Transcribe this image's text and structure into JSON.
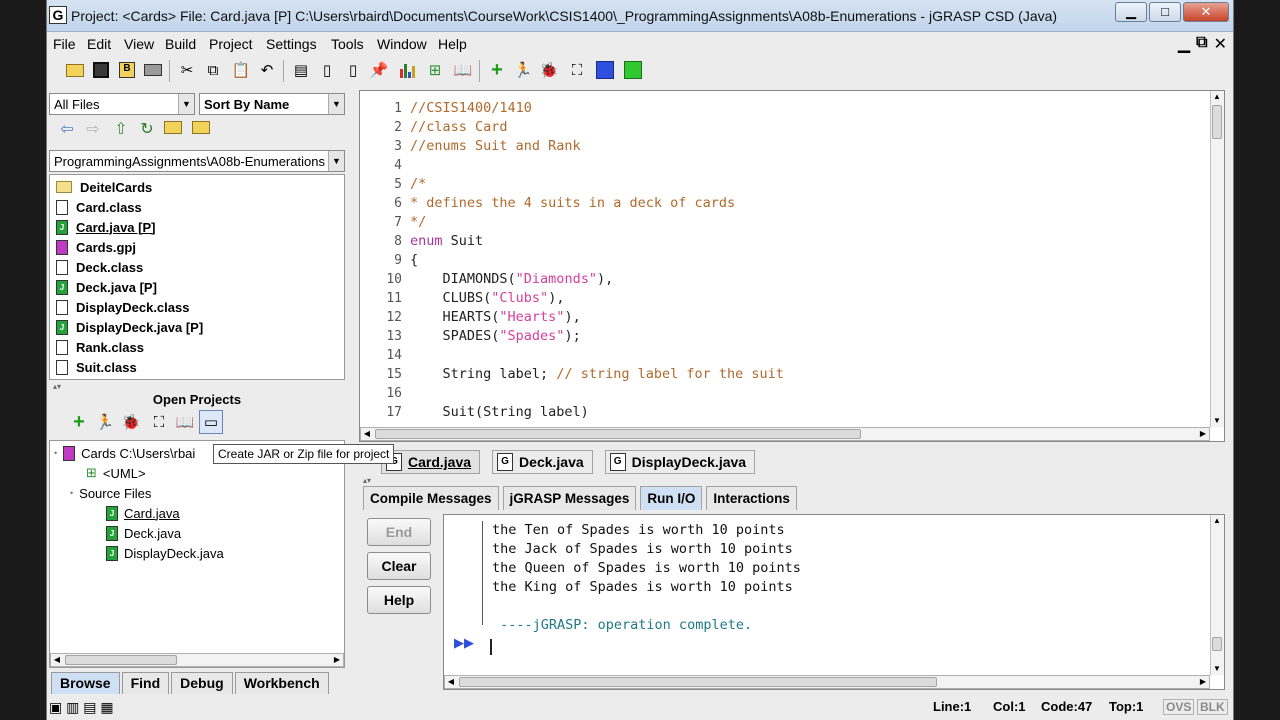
{
  "window": {
    "title": "Project: <Cards>    File: Card.java [P]   C:\\Users\\rbaird\\Documents\\CourseWork\\CSIS1400\\_ProgrammingAssignments\\A08b-Enumerations - jGRASP CSD (Java)",
    "app_icon": "G",
    "minimize_glyph": "▁",
    "maximize_glyph": "□",
    "close_glyph": "✕"
  },
  "menu": {
    "items": [
      "File",
      "Edit",
      "View",
      "Build",
      "Project",
      "Settings",
      "Tools",
      "Window",
      "Help"
    ],
    "mdi_min": "▁",
    "mdi_restore": "⧉",
    "mdi_close": "✕"
  },
  "toolbar": {
    "icons": [
      "open-folder-icon",
      "save-icon",
      "save-all-icon",
      "print-icon",
      "cut-icon",
      "copy-icon",
      "paste-icon",
      "undo-icon",
      "browse-icon",
      "new-file-icon",
      "page-icon",
      "pin-icon",
      "chart-icon",
      "uml-icon",
      "book-icon",
      "compile-icon",
      "run-icon",
      "debug-icon",
      "viewer-icon",
      "square-icon",
      "green-panel-icon"
    ]
  },
  "browse": {
    "filter": "All Files",
    "sort": "Sort By Name",
    "path": "ProgrammingAssignments\\A08b-Enumerations",
    "files": [
      {
        "name": "DeitelCards",
        "kind": "folder"
      },
      {
        "name": "Card.class",
        "kind": "class"
      },
      {
        "name": "Card.java [P]",
        "kind": "java"
      },
      {
        "name": "Cards.gpj",
        "kind": "gpj"
      },
      {
        "name": "Deck.class",
        "kind": "class"
      },
      {
        "name": "Deck.java [P]",
        "kind": "java"
      },
      {
        "name": "DisplayDeck.class",
        "kind": "class"
      },
      {
        "name": "DisplayDeck.java [P]",
        "kind": "java"
      },
      {
        "name": "Rank.class",
        "kind": "class"
      },
      {
        "name": "Suit.class",
        "kind": "class"
      }
    ]
  },
  "projects": {
    "title": "Open Projects",
    "tooltip": "Create JAR or Zip file for project",
    "root": "Cards  C:\\Users\\rbai",
    "uml": "<UML>",
    "source_files": "Source Files",
    "sources": [
      "Card.java",
      "Deck.java",
      "DisplayDeck.java"
    ]
  },
  "left_tabs": [
    "Browse",
    "Find",
    "Debug",
    "Workbench"
  ],
  "editor": {
    "lines": [
      {
        "n": "1",
        "text": "//CSIS1400/1410",
        "type": "comment"
      },
      {
        "n": "2",
        "text": "//class Card",
        "type": "comment"
      },
      {
        "n": "3",
        "text": "//enums Suit and Rank",
        "type": "comment"
      },
      {
        "n": "4",
        "text": "",
        "type": "plain"
      },
      {
        "n": "5",
        "text": "/*",
        "type": "comment"
      },
      {
        "n": "6",
        "text": "* defines the 4 suits in a deck of cards",
        "type": "comment"
      },
      {
        "n": "7",
        "text": "*/",
        "type": "comment"
      },
      {
        "n": "8",
        "kw": "enum",
        "rest": " Suit",
        "type": "keyword"
      },
      {
        "n": "9",
        "text": "{",
        "type": "plain"
      },
      {
        "n": "10",
        "pre": "    DIAMONDS(",
        "str": "\"Diamonds\"",
        "post": "),",
        "type": "string"
      },
      {
        "n": "11",
        "pre": "    CLUBS(",
        "str": "\"Clubs\"",
        "post": "),",
        "type": "string"
      },
      {
        "n": "12",
        "pre": "    HEARTS(",
        "str": "\"Hearts\"",
        "post": "),",
        "type": "string"
      },
      {
        "n": "13",
        "pre": "    SPADES(",
        "str": "\"Spades\"",
        "post": ");",
        "type": "string"
      },
      {
        "n": "14",
        "text": "",
        "type": "plain"
      },
      {
        "n": "15",
        "pre": "    String label; ",
        "cm": "// string label for the suit",
        "type": "trailing-comment"
      },
      {
        "n": "16",
        "text": "",
        "type": "plain"
      },
      {
        "n": "17",
        "text": "    Suit(String label)",
        "type": "plain"
      }
    ]
  },
  "file_tabs": [
    "Card.java",
    "Deck.java",
    "DisplayDeck.java"
  ],
  "message_tabs": [
    "Compile Messages",
    "jGRASP Messages",
    "Run I/O",
    "Interactions"
  ],
  "active_message_tab": "Run I/O",
  "io_buttons": {
    "end": "End",
    "clear": "Clear",
    "help": "Help"
  },
  "output": {
    "lines": [
      "the Ten of Spades is worth 10 points",
      "the Jack of Spades is worth 10 points",
      "the Queen of Spades is worth 10 points",
      "the King of Spades is worth 10 points"
    ],
    "complete": " ----jGRASP: operation complete.",
    "run_marker": "▶▶"
  },
  "status": {
    "line": "Line:1",
    "col": "Col:1",
    "code": "Code:47",
    "top": "Top:1",
    "ovs": "OVS",
    "blk": "BLK"
  }
}
